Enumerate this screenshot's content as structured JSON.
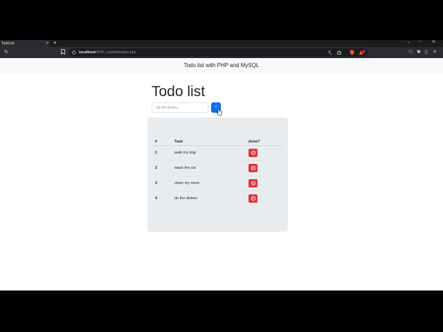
{
  "browser": {
    "tab_title": "TodoList",
    "tab_close": "×",
    "new_tab": "+",
    "url_host": "localhost",
    "url_path": "/PHP_todolist/index.php",
    "window_controls": [
      "⌄",
      "–",
      "□",
      "✕"
    ]
  },
  "navbar": {
    "title": "Todo list with PHP and MySQL"
  },
  "page": {
    "heading": "Todo list",
    "input_placeholder": "do the dishes...",
    "add_label": "+"
  },
  "table": {
    "headers": {
      "id": "#",
      "task": "Task",
      "done": "done?"
    },
    "rows": [
      {
        "id": "1",
        "task": "walk my dog"
      },
      {
        "id": "2",
        "task": "wash the car"
      },
      {
        "id": "3",
        "task": "clean my room"
      },
      {
        "id": "4",
        "task": "do the dishes"
      }
    ]
  },
  "colors": {
    "primary": "#0d6efd",
    "danger": "#dc3545",
    "card_bg": "#e9ecef",
    "navbar_bg": "#f8f9fa"
  },
  "icons": {
    "delete": "x-circle-icon",
    "reload": "reload-icon",
    "bookmark": "bookmark-icon"
  }
}
